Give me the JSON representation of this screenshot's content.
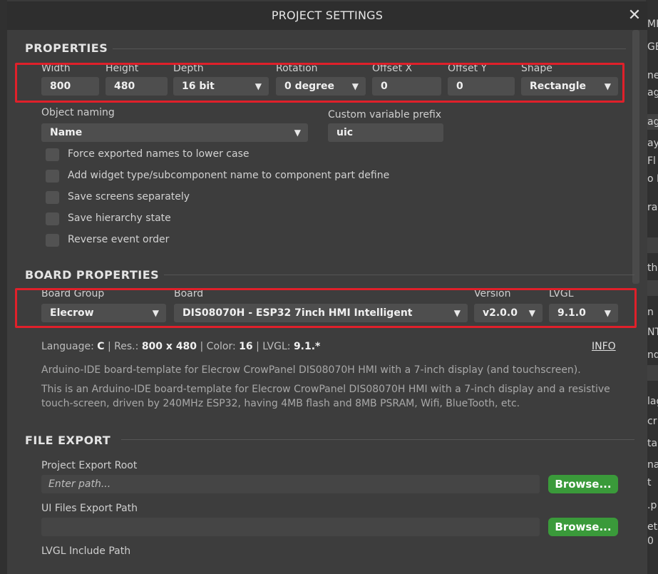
{
  "dialog": {
    "title": "PROJECT SETTINGS",
    "close_icon": "close-icon"
  },
  "background_panel": {
    "texts": [
      "MP",
      "GE",
      "ne",
      "ag",
      "ag",
      "ay",
      "Fl",
      "o L",
      "ra",
      "th",
      "n",
      "NT",
      "nd",
      "lag",
      "cr",
      "ta",
      "na",
      "t",
      ".p",
      "ets",
      "0"
    ]
  },
  "properties": {
    "section_title": "PROPERTIES",
    "width": {
      "label": "Width",
      "value": "800"
    },
    "height": {
      "label": "Height",
      "value": "480"
    },
    "depth": {
      "label": "Depth",
      "value": "16 bit"
    },
    "rotation": {
      "label": "Rotation",
      "value": "0 degree"
    },
    "offset_x": {
      "label": "Offset X",
      "value": "0"
    },
    "offset_y": {
      "label": "Offset Y",
      "value": "0"
    },
    "shape": {
      "label": "Shape",
      "value": "Rectangle"
    },
    "object_naming": {
      "label": "Object naming",
      "value": "Name"
    },
    "custom_prefix": {
      "label": "Custom variable prefix",
      "value": "uic"
    },
    "checkboxes": [
      "Force exported names to lower case",
      "Add widget type/subcomponent name to component part define",
      "Save screens separately",
      "Save hierarchy state",
      "Reverse event order"
    ]
  },
  "board_properties": {
    "section_title": "BOARD PROPERTIES",
    "board_group": {
      "label": "Board Group",
      "value": "Elecrow"
    },
    "board": {
      "label": "Board",
      "value": "DIS08070H - ESP32 7inch HMI Intelligent"
    },
    "version": {
      "label": "Version",
      "value": "v2.0.0"
    },
    "lvgl": {
      "label": "LVGL",
      "value": "9.1.0"
    },
    "info": {
      "language_label": "Language:",
      "language": "C",
      "res_label": "Res.:",
      "res": "800 x 480",
      "color_label": "Color:",
      "color": "16",
      "lvgl_label": "LVGL:",
      "lvgl": "9.1.*",
      "sep": "|",
      "link": "INFO"
    },
    "desc_short": "Arduino-IDE board-template for Elecrow CrowPanel DIS08070H HMI with a 7-inch display (and touchscreen).",
    "desc_long": "This is an Arduino-IDE board-template for Elecrow CrowPanel DIS08070H HMI with a 7-inch display and a resistive touch-screen, driven by 240MHz ESP32, having 4MB flash and 8MB PSRAM, Wifi, BlueTooth, etc."
  },
  "file_export": {
    "section_title": "FILE EXPORT",
    "project_export_root": {
      "label": "Project Export Root",
      "placeholder": "Enter path...",
      "button": "Browse..."
    },
    "ui_files_export_path": {
      "label": "UI Files Export Path",
      "value": "",
      "button": "Browse..."
    },
    "lvgl_include_path": {
      "label": "LVGL Include Path"
    }
  },
  "colors": {
    "highlight": "#e0202a",
    "browse_button": "#3a9a3a",
    "dialog_bg": "#3d3d3d"
  },
  "icons": {
    "dropdown": "chevron-down-icon"
  }
}
